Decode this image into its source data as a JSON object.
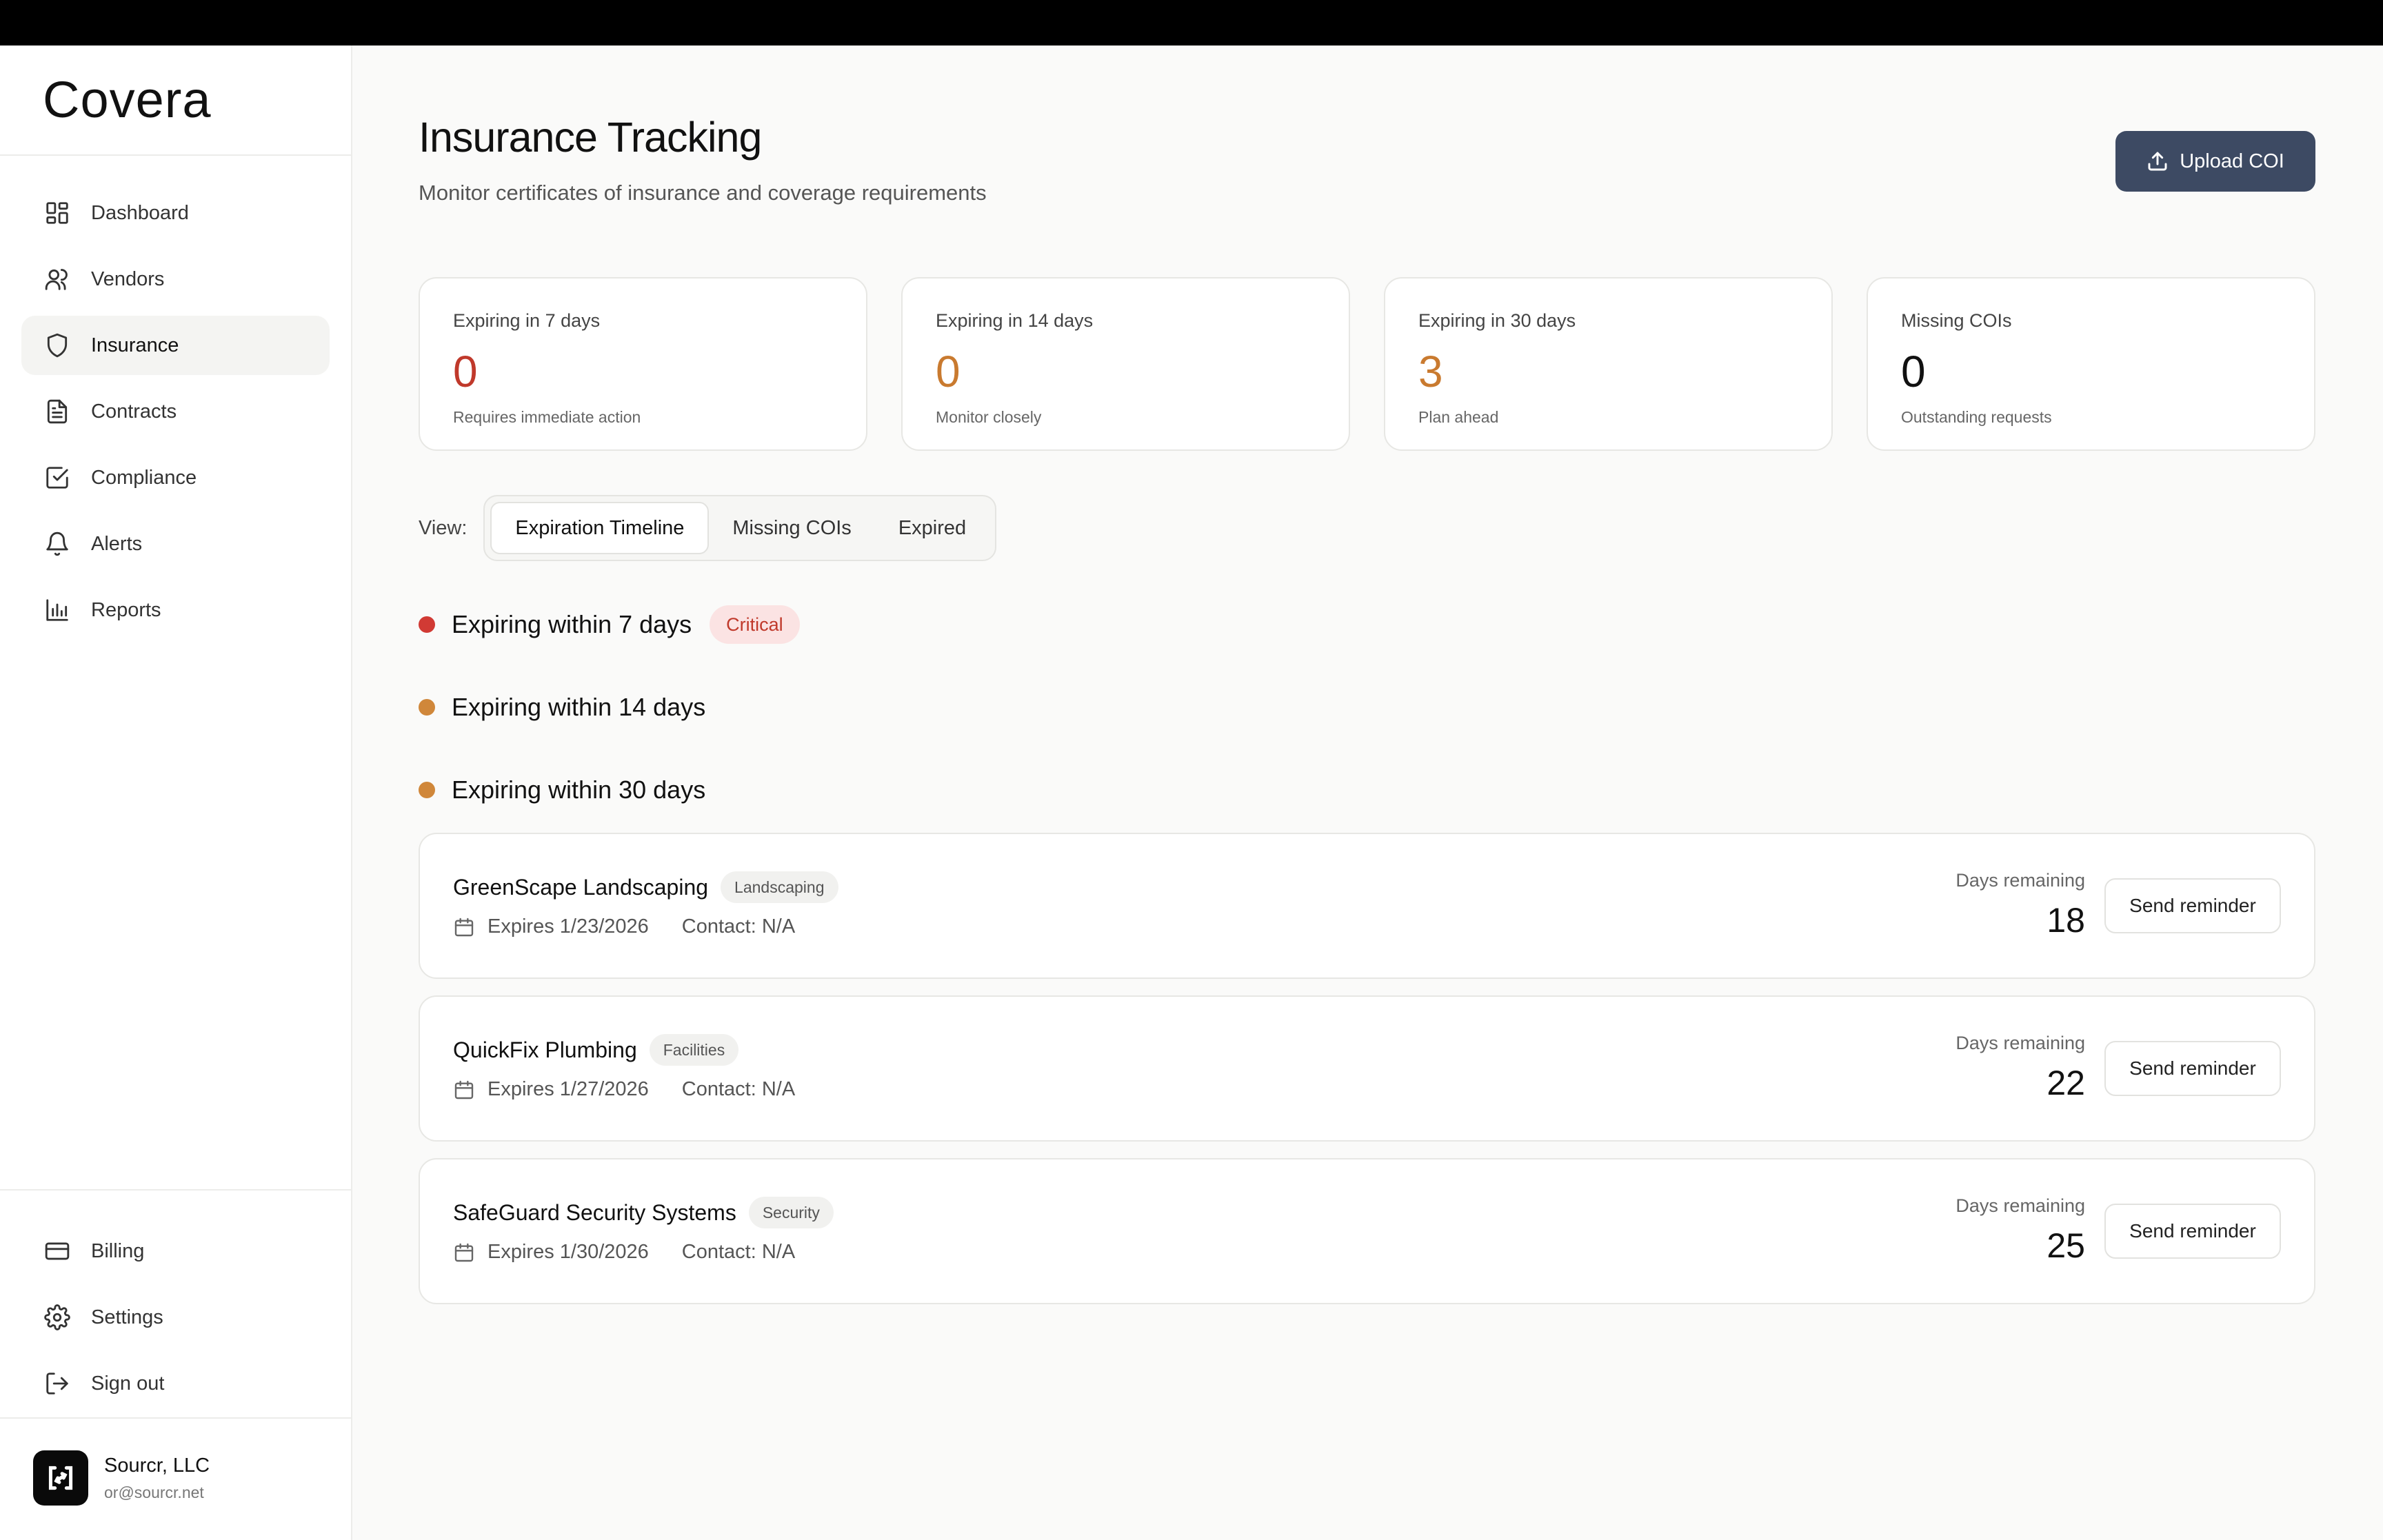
{
  "app": {
    "name": "Covera"
  },
  "sidebar": {
    "items": [
      {
        "label": "Dashboard",
        "icon": "dashboard-icon"
      },
      {
        "label": "Vendors",
        "icon": "users-icon"
      },
      {
        "label": "Insurance",
        "icon": "shield-icon",
        "active": true
      },
      {
        "label": "Contracts",
        "icon": "document-icon"
      },
      {
        "label": "Compliance",
        "icon": "checkbox-icon"
      },
      {
        "label": "Alerts",
        "icon": "bell-icon"
      },
      {
        "label": "Reports",
        "icon": "bar-chart-icon"
      }
    ],
    "bottom_items": [
      {
        "label": "Billing",
        "icon": "credit-card-icon"
      },
      {
        "label": "Settings",
        "icon": "gear-icon"
      },
      {
        "label": "Sign out",
        "icon": "sign-out-icon"
      }
    ],
    "account": {
      "name": "Sourcr, LLC",
      "email": "or@sourcr.net"
    }
  },
  "header": {
    "title": "Insurance Tracking",
    "subtitle": "Monitor certificates of insurance and coverage requirements",
    "upload_label": "Upload COI"
  },
  "stats": [
    {
      "label": "Expiring in 7 days",
      "value": "0",
      "note": "Requires immediate action",
      "color": "#c0392b"
    },
    {
      "label": "Expiring in 14 days",
      "value": "0",
      "note": "Monitor closely",
      "color": "#c97a2f"
    },
    {
      "label": "Expiring in 30 days",
      "value": "3",
      "note": "Plan ahead",
      "color": "#c97a2f"
    },
    {
      "label": "Missing COIs",
      "value": "0",
      "note": "Outstanding requests",
      "color": "#111111"
    }
  ],
  "view": {
    "label": "View:",
    "tabs": [
      "Expiration Timeline",
      "Missing COIs",
      "Expired"
    ],
    "active": 0
  },
  "groups": [
    {
      "title": "Expiring within 7 days",
      "badge": "Critical",
      "color": "#d13a34"
    },
    {
      "title": "Expiring within 14 days",
      "color": "#d0873a"
    },
    {
      "title": "Expiring within 30 days",
      "color": "#d0873a"
    }
  ],
  "vendors": [
    {
      "name": "GreenScape Landscaping",
      "tag": "Landscaping",
      "expires": "Expires 1/23/2026",
      "contact": "Contact: N/A",
      "days_label": "Days remaining",
      "days": "18",
      "action": "Send reminder"
    },
    {
      "name": "QuickFix Plumbing",
      "tag": "Facilities",
      "expires": "Expires 1/27/2026",
      "contact": "Contact: N/A",
      "days_label": "Days remaining",
      "days": "22",
      "action": "Send reminder"
    },
    {
      "name": "SafeGuard Security Systems",
      "tag": "Security",
      "expires": "Expires 1/30/2026",
      "contact": "Contact: N/A",
      "days_label": "Days remaining",
      "days": "25",
      "action": "Send reminder"
    }
  ]
}
